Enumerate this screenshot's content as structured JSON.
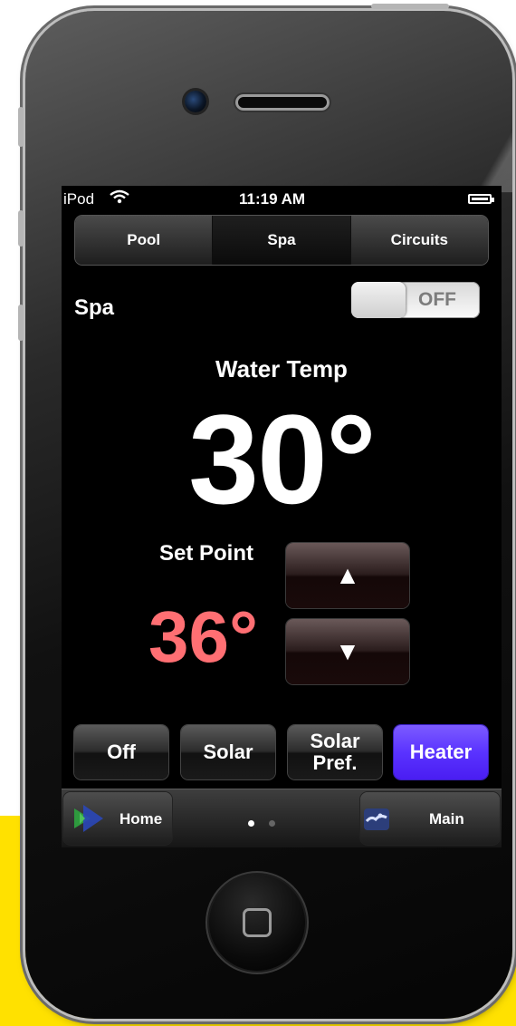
{
  "status_bar": {
    "carrier": "iPod",
    "time": "11:19 AM"
  },
  "tabs": [
    {
      "label": "Pool",
      "active": false
    },
    {
      "label": "Spa",
      "active": true
    },
    {
      "label": "Circuits",
      "active": false
    }
  ],
  "spa": {
    "label": "Spa",
    "toggle_state": "OFF"
  },
  "water_temp": {
    "label": "Water Temp",
    "value": "30°"
  },
  "set_point": {
    "label": "Set Point",
    "value": "36°"
  },
  "arrows": {
    "up": "▲",
    "down": "▼"
  },
  "heat_modes": [
    {
      "label": "Off",
      "selected": false
    },
    {
      "label": "Solar",
      "selected": false
    },
    {
      "label": "Solar Pref.",
      "selected": false
    },
    {
      "label": "Heater",
      "selected": true
    }
  ],
  "bottom_bar": {
    "home_label": "Home",
    "main_label": "Main",
    "page_count": 2,
    "current_page": 1
  },
  "colors": {
    "set_point": "#ff6f73",
    "heater_selected": "#5a33ff",
    "toggle_text": "#7c7c7c",
    "background_accent": "#ffe100"
  },
  "icons": {
    "wifi": "wifi-icon",
    "battery": "battery-icon",
    "home": "home-logo-icon",
    "main": "pool-icon",
    "home_key": "home-key-icon"
  }
}
